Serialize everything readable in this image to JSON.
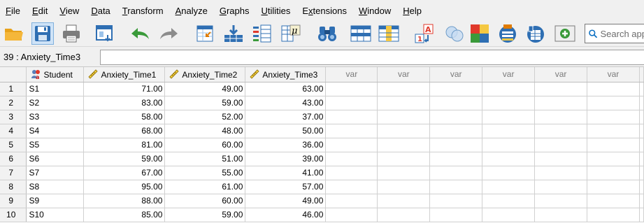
{
  "menu": [
    {
      "label": "File",
      "mnemonic": "F",
      "rest": "ile"
    },
    {
      "label": "Edit",
      "mnemonic": "E",
      "rest": "dit"
    },
    {
      "label": "View",
      "mnemonic": "V",
      "rest": "iew"
    },
    {
      "label": "Data",
      "mnemonic": "D",
      "rest": "ata"
    },
    {
      "label": "Transform",
      "mnemonic": "T",
      "rest": "ransform"
    },
    {
      "label": "Analyze",
      "mnemonic": "A",
      "rest": "nalyze"
    },
    {
      "label": "Graphs",
      "mnemonic": "G",
      "rest": "raphs"
    },
    {
      "label": "Utilities",
      "mnemonic": "U",
      "rest": "tilities"
    },
    {
      "label": "Extensions",
      "mnemonic": "x",
      "prefix": "E",
      "rest": "tensions"
    },
    {
      "label": "Window",
      "mnemonic": "W",
      "rest": "indow"
    },
    {
      "label": "Help",
      "mnemonic": "H",
      "rest": "elp"
    }
  ],
  "toolbar": {
    "icons": [
      "open-folder-icon",
      "save-icon",
      "print-icon",
      "recall-dialog-icon",
      "undo-icon",
      "redo-icon",
      "goto-case-icon",
      "goto-variable-icon",
      "variables-icon",
      "run-descriptives-icon",
      "find-icon",
      "insert-cases-icon",
      "insert-variable-icon",
      "split-file-icon",
      "weight-cases-icon",
      "select-cases-icon",
      "value-labels-icon",
      "use-variable-sets-icon",
      "show-all-variables-icon",
      "spell-check-icon"
    ],
    "search_placeholder": "Search app",
    "accent": "#0a6fc2"
  },
  "refbar": {
    "cell_ref": "39 : Anxiety_Time3",
    "cell_value": ""
  },
  "grid": {
    "columns": [
      {
        "label": "Student",
        "type": "string"
      },
      {
        "label": "Anxiety_Time1",
        "type": "scale"
      },
      {
        "label": "Anxiety_Time2",
        "type": "scale"
      },
      {
        "label": "Anxiety_Time3",
        "type": "scale"
      },
      {
        "label": "var",
        "type": "empty"
      },
      {
        "label": "var",
        "type": "empty"
      },
      {
        "label": "var",
        "type": "empty"
      },
      {
        "label": "var",
        "type": "empty"
      },
      {
        "label": "var",
        "type": "empty"
      },
      {
        "label": "var",
        "type": "empty"
      }
    ],
    "rows": [
      {
        "n": "1",
        "cells": [
          "S1",
          "71.00",
          "49.00",
          "63.00"
        ]
      },
      {
        "n": "2",
        "cells": [
          "S2",
          "83.00",
          "59.00",
          "43.00"
        ]
      },
      {
        "n": "3",
        "cells": [
          "S3",
          "58.00",
          "52.00",
          "37.00"
        ]
      },
      {
        "n": "4",
        "cells": [
          "S4",
          "68.00",
          "48.00",
          "50.00"
        ]
      },
      {
        "n": "5",
        "cells": [
          "S5",
          "81.00",
          "60.00",
          "36.00"
        ]
      },
      {
        "n": "6",
        "cells": [
          "S6",
          "59.00",
          "51.00",
          "39.00"
        ]
      },
      {
        "n": "7",
        "cells": [
          "S7",
          "67.00",
          "55.00",
          "41.00"
        ]
      },
      {
        "n": "8",
        "cells": [
          "S8",
          "95.00",
          "61.00",
          "57.00"
        ]
      },
      {
        "n": "9",
        "cells": [
          "S9",
          "88.00",
          "60.00",
          "49.00"
        ]
      },
      {
        "n": "10",
        "cells": [
          "S10",
          "85.00",
          "59.00",
          "46.00"
        ]
      }
    ]
  }
}
